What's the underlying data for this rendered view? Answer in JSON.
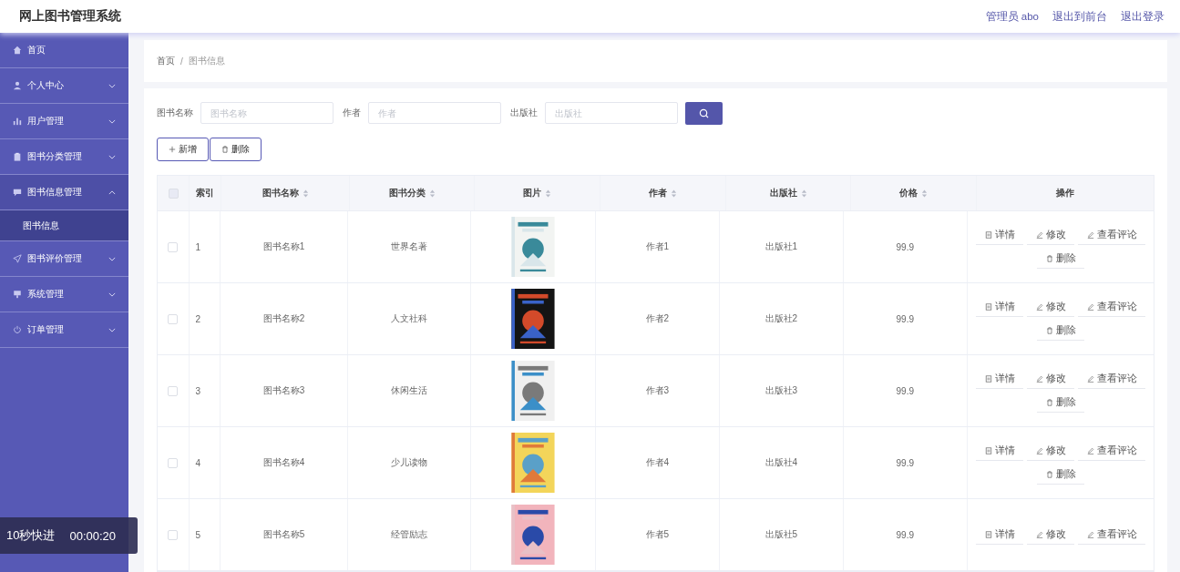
{
  "header": {
    "title": "网上图书管理系统",
    "links": [
      {
        "label": "管理员 abo"
      },
      {
        "label": "退出到前台"
      },
      {
        "label": "退出登录"
      }
    ]
  },
  "sidebar": {
    "items": [
      {
        "label": "首页",
        "selected": false
      },
      {
        "label": "个人中心",
        "expanded": false,
        "selected": false,
        "collapsible": true
      },
      {
        "label": "用户管理",
        "expanded": false,
        "selected": false,
        "collapsible": true
      },
      {
        "label": "图书分类管理",
        "expanded": false,
        "selected": false,
        "collapsible": true
      },
      {
        "label": "图书信息管理",
        "expanded": true,
        "selected": true,
        "collapsible": true,
        "children": [
          {
            "label": "图书信息",
            "selected": true
          }
        ]
      },
      {
        "label": "图书评价管理",
        "expanded": false,
        "selected": false,
        "collapsible": true
      },
      {
        "label": "系统管理",
        "expanded": false,
        "selected": false,
        "collapsible": true
      },
      {
        "label": "订单管理",
        "expanded": false,
        "selected": false,
        "collapsible": true
      }
    ]
  },
  "breadcrumb": {
    "separator": "/",
    "items": [
      "首页",
      "图书信息"
    ]
  },
  "search": {
    "fields": [
      {
        "label": "图书名称",
        "placeholder": "图书名称"
      },
      {
        "label": "作者",
        "placeholder": "作者"
      },
      {
        "label": "出版社",
        "placeholder": "出版社"
      }
    ]
  },
  "toolbar": [
    {
      "label": "新增",
      "kind": "add"
    },
    {
      "label": "删除",
      "kind": "delete"
    }
  ],
  "table": {
    "all_selected": false,
    "columns": [
      {
        "label": "索引",
        "sortable": false
      },
      {
        "label": "图书名称",
        "sortable": true
      },
      {
        "label": "图书分类",
        "sortable": true
      },
      {
        "label": "图片",
        "sortable": true
      },
      {
        "label": "作者",
        "sortable": true
      },
      {
        "label": "出版社",
        "sortable": true
      },
      {
        "label": "价格",
        "sortable": true
      },
      {
        "label": "操作",
        "sortable": false
      }
    ],
    "rows": [
      {
        "selected": false,
        "index": "1",
        "name": "图书名称1",
        "category": "世界名著",
        "author": "作者1",
        "publisher": "出版社1",
        "price": "99.9",
        "actions": [
          {
            "label": "详情",
            "kind": "detail"
          },
          {
            "label": "修改",
            "kind": "edit"
          },
          {
            "label": "查看评论",
            "kind": "edit"
          },
          {
            "label": "删除",
            "kind": "delete"
          }
        ]
      },
      {
        "selected": false,
        "index": "2",
        "name": "图书名称2",
        "category": "人文社科",
        "author": "作者2",
        "publisher": "出版社2",
        "price": "99.9",
        "actions": [
          {
            "label": "详情",
            "kind": "detail"
          },
          {
            "label": "修改",
            "kind": "edit"
          },
          {
            "label": "查看评论",
            "kind": "edit"
          },
          {
            "label": "删除",
            "kind": "delete"
          }
        ]
      },
      {
        "selected": false,
        "index": "3",
        "name": "图书名称3",
        "category": "休闲生活",
        "author": "作者3",
        "publisher": "出版社3",
        "price": "99.9",
        "actions": [
          {
            "label": "详情",
            "kind": "detail"
          },
          {
            "label": "修改",
            "kind": "edit"
          },
          {
            "label": "查看评论",
            "kind": "edit"
          },
          {
            "label": "删除",
            "kind": "delete"
          }
        ]
      },
      {
        "selected": false,
        "index": "4",
        "name": "图书名称4",
        "category": "少儿读物",
        "author": "作者4",
        "publisher": "出版社4",
        "price": "99.9",
        "actions": [
          {
            "label": "详情",
            "kind": "detail"
          },
          {
            "label": "修改",
            "kind": "edit"
          },
          {
            "label": "查看评论",
            "kind": "edit"
          },
          {
            "label": "删除",
            "kind": "delete"
          }
        ]
      },
      {
        "selected": false,
        "index": "5",
        "name": "图书名称5",
        "category": "经管励志",
        "author": "作者5",
        "publisher": "出版社5",
        "price": "99.9",
        "actions": [
          {
            "label": "详情",
            "kind": "detail"
          },
          {
            "label": "修改",
            "kind": "edit"
          },
          {
            "label": "查看评论",
            "kind": "edit"
          }
        ]
      }
    ]
  },
  "video_overlay": {
    "label": "10秒快进",
    "time": "00:00:20"
  }
}
